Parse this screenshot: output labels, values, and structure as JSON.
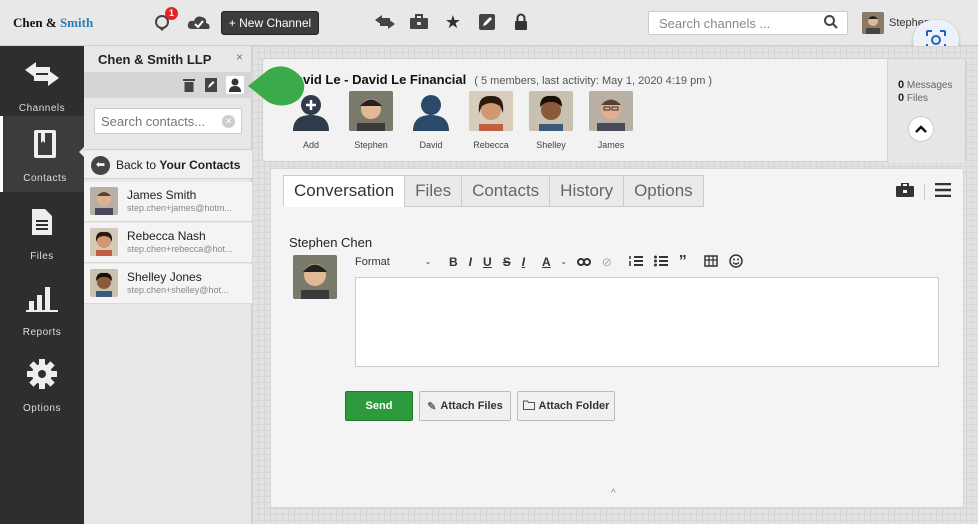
{
  "brand": {
    "part1": "Chen &",
    "part2": "Smith"
  },
  "topbar": {
    "notifications_badge": "1",
    "new_channel_label": "+ New Channel",
    "search_placeholder": "Search channels ...",
    "user_name": "Stephen"
  },
  "nav": {
    "items": [
      {
        "label": "Channels",
        "icon": "swap-arrows-icon"
      },
      {
        "label": "Contacts",
        "icon": "book-icon"
      },
      {
        "label": "Files",
        "icon": "file-icon"
      },
      {
        "label": "Reports",
        "icon": "bar-chart-icon"
      },
      {
        "label": "Options",
        "icon": "gear-icon"
      }
    ]
  },
  "contacts_panel": {
    "title": "Chen & Smith LLP",
    "close": "×",
    "search_placeholder": "Search contacts...",
    "back_prefix": "Back to ",
    "back_bold": "Your Contacts",
    "contacts": [
      {
        "name": "James Smith",
        "email": "step.chen+james@hotm..."
      },
      {
        "name": "Rebecca Nash",
        "email": "step.chen+rebecca@hot..."
      },
      {
        "name": "Shelley Jones",
        "email": "step.chen+shelley@hot..."
      }
    ]
  },
  "channel": {
    "title": "vid Le - David Le Financial",
    "meta": "( 5 members, last activity: May 1, 2020 4:19 pm )",
    "members": [
      "Add",
      "Stephen",
      "David",
      "Rebecca",
      "Shelley",
      "James"
    ],
    "messages_count": "0",
    "messages_label": "Messages",
    "files_count": "0",
    "files_label": "Files"
  },
  "tabs": [
    "Conversation",
    "Files",
    "Contacts",
    "History",
    "Options"
  ],
  "composer": {
    "author": "Stephen Chen",
    "format_label": "Format",
    "send_label": "Send",
    "attach_files_label": "Attach Files",
    "attach_folder_label": "Attach Folder"
  },
  "colors": {
    "accent_green": "#2e9a3e",
    "nav_bg": "#2e2e2e",
    "pointer_green": "#3aaa4a"
  }
}
